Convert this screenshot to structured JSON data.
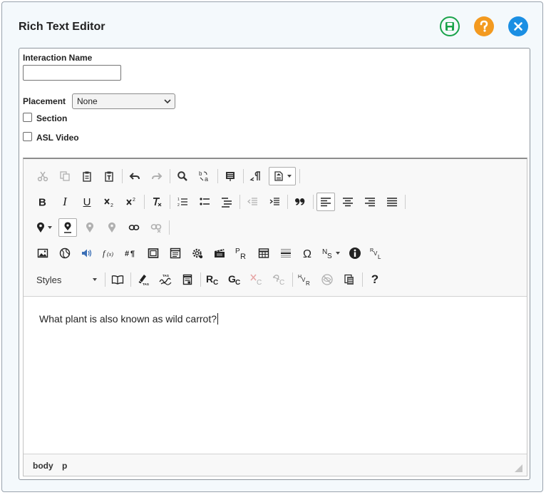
{
  "dialog": {
    "title": "Rich Text Editor",
    "colors": {
      "save": "#1aa34a",
      "help": "#f39a20",
      "close": "#1b8fe3"
    }
  },
  "form": {
    "interaction_name_label": "Interaction Name",
    "interaction_name_value": "",
    "placement_label": "Placement",
    "placement_value": "None",
    "section_label": "Section",
    "section_checked": false,
    "asl_video_label": "ASL Video",
    "asl_video_checked": false
  },
  "toolbar": {
    "italic": "I",
    "underline": "U",
    "styles_label": "Styles",
    "help": "?"
  },
  "editor": {
    "content": "What plant is also known as wild carrot?",
    "path": [
      "body",
      "p"
    ]
  }
}
